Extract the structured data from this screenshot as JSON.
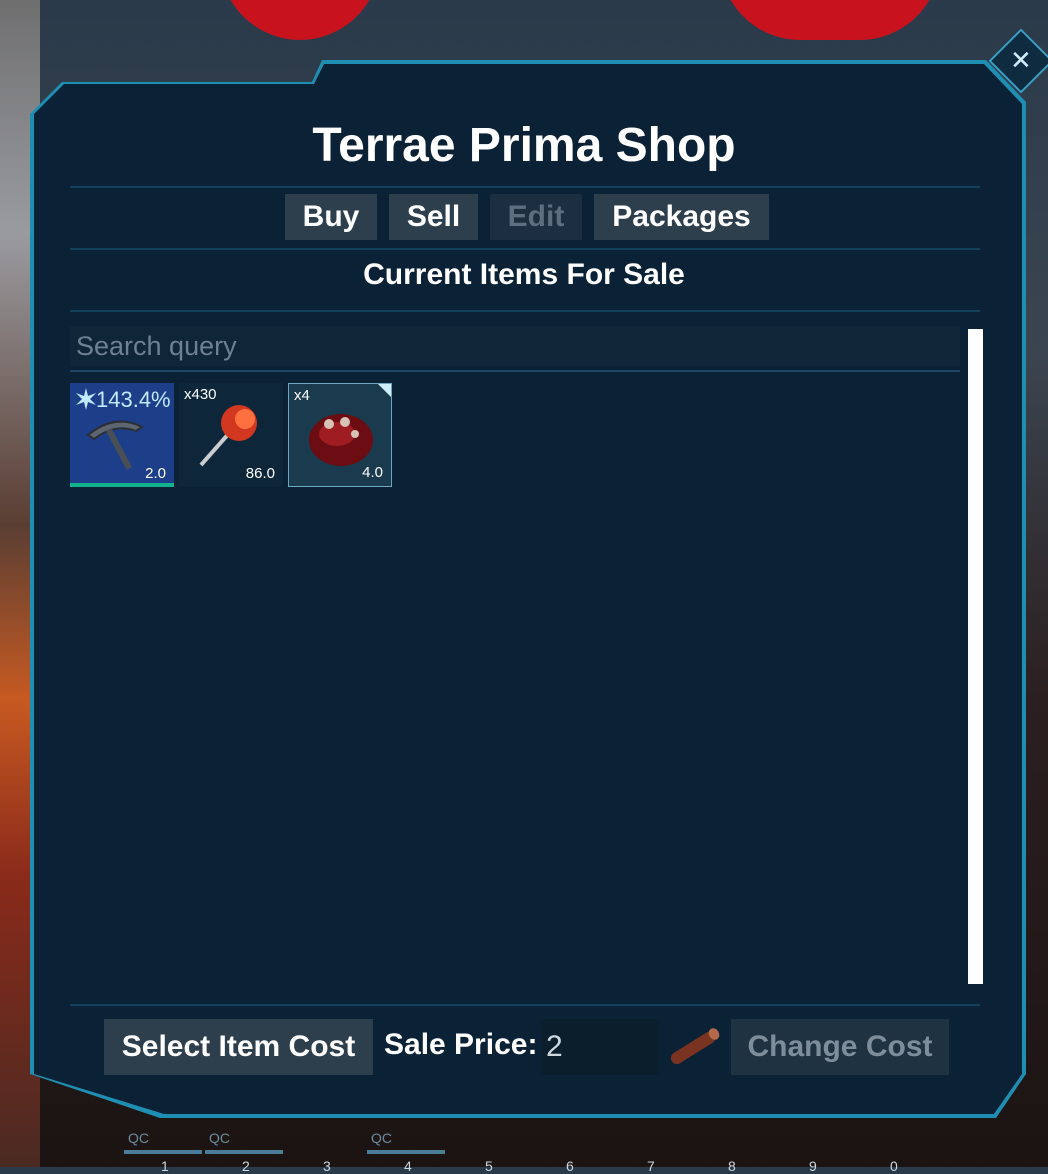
{
  "window": {
    "title": "Terrae Prima Shop",
    "close_icon": "close-icon"
  },
  "tabs": [
    {
      "label": "Buy",
      "enabled": true
    },
    {
      "label": "Sell",
      "enabled": true
    },
    {
      "label": "Edit",
      "enabled": false
    },
    {
      "label": "Packages",
      "enabled": true
    }
  ],
  "section_title": "Current Items For Sale",
  "search": {
    "placeholder": "Search query",
    "value": ""
  },
  "items": [
    {
      "icon": "pickaxe-icon",
      "quality": "143.4%",
      "quality_icon": "star-burst-icon",
      "weight": "2.0",
      "durability_fraction": 1.0,
      "quantity": ""
    },
    {
      "icon": "arrow-feather-icon",
      "quantity": "x430",
      "weight": "86.0"
    },
    {
      "icon": "red-meat-icon",
      "quantity": "x4",
      "weight": "4.0",
      "selected": true
    }
  ],
  "footer": {
    "select_cost_label": "Select Item Cost",
    "sale_price_label": "Sale Price:",
    "sale_price_value": "2",
    "cost_item_icon": "wood-icon",
    "change_cost_label": "Change Cost"
  },
  "hotbar": {
    "slots": [
      {
        "label": "QC"
      },
      {
        "label": "QC"
      },
      {
        "label": ""
      },
      {
        "label": "QC"
      }
    ],
    "numbers": [
      "1",
      "2",
      "3",
      "4",
      "5",
      "6",
      "7",
      "8",
      "9",
      "0"
    ]
  },
  "colors": {
    "panel": "#0b2236",
    "border": "#1e8fb3",
    "button": "#2d3e4d",
    "accent": "#2aa6d0"
  }
}
